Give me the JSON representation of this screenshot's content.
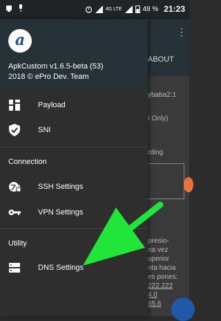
{
  "status_bar": {
    "network_label": "4G LTE",
    "battery": "48 %",
    "time": "21:23"
  },
  "background": {
    "tab_label": "ABOUT",
    "text_lines": [
      "ybaba2:1",
      "t Only)",
      "rding",
      "presio-",
      "na vez",
      "uperior",
      "nta hacia",
      "es pones:",
      "222.222",
      "4.0",
      "65.6"
    ]
  },
  "drawer": {
    "app_name": "ApkCustom v1.6.5-beta (53)",
    "copyright": "2018 © ePro Dev. Team",
    "items_main": [
      {
        "label": "Payload",
        "icon": "payload-grid-icon"
      },
      {
        "label": "SNI",
        "icon": "shield-check-icon"
      }
    ],
    "section_connection": "Connection",
    "items_connection": [
      {
        "label": "SSH Settings",
        "icon": "globe-lock-icon"
      },
      {
        "label": "VPN Settings",
        "icon": "key-icon"
      }
    ],
    "section_utility": "Utility",
    "items_utility": [
      {
        "label": "DNS Settings",
        "icon": "dns-server-icon"
      }
    ]
  },
  "annotation": {
    "arrow_color": "#22e53a"
  }
}
